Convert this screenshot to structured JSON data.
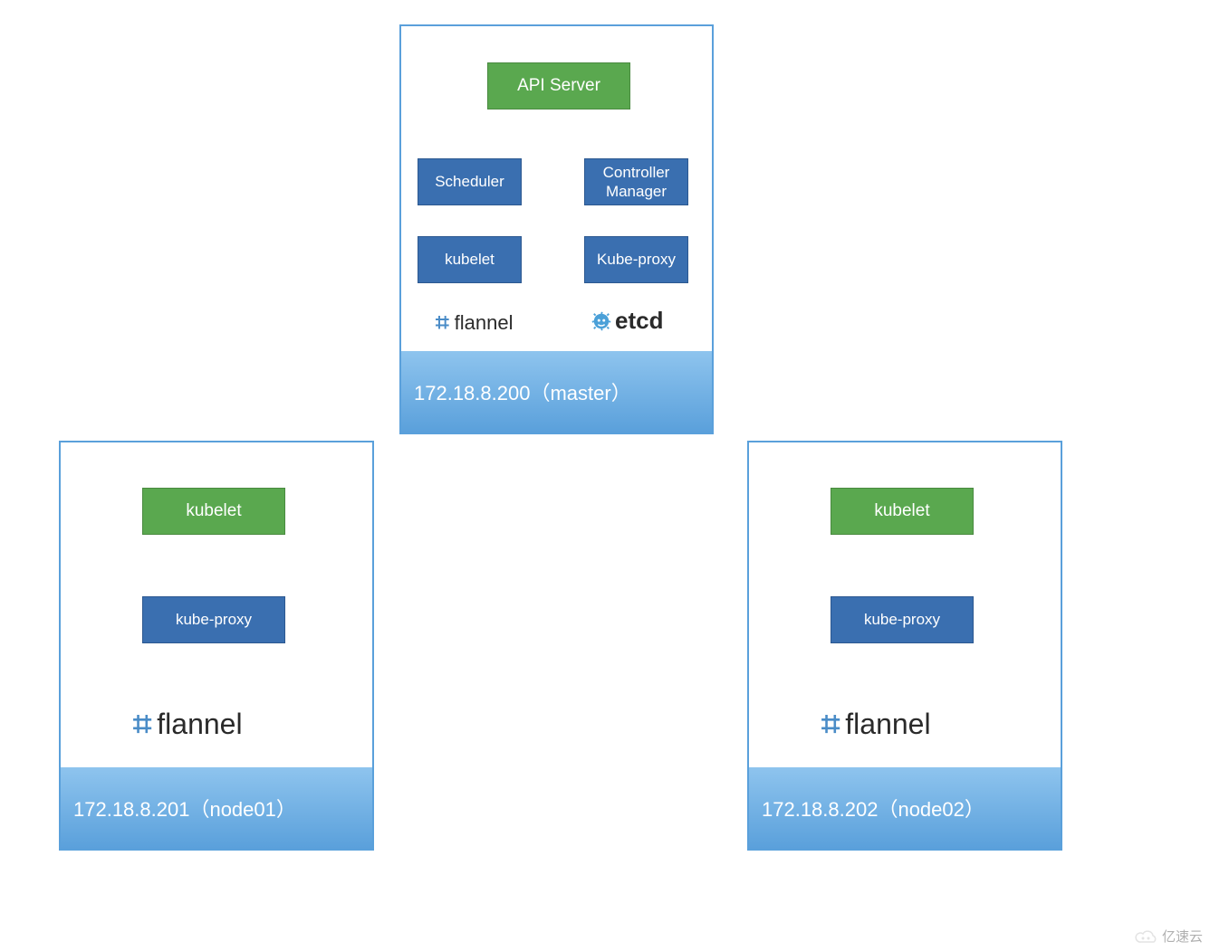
{
  "master": {
    "label": "172.18.8.200（master）",
    "api_server": "API Server",
    "scheduler": "Scheduler",
    "controller_manager": "Controller\nManager",
    "kubelet": "kubelet",
    "kube_proxy": "Kube-proxy",
    "flannel": "flannel",
    "etcd": "etcd"
  },
  "node01": {
    "label": "172.18.8.201（node01）",
    "kubelet": "kubelet",
    "kube_proxy": "kube-proxy",
    "flannel": "flannel"
  },
  "node02": {
    "label": "172.18.8.202（node02）",
    "kubelet": "kubelet",
    "kube_proxy": "kube-proxy",
    "flannel": "flannel"
  },
  "watermark": "亿速云"
}
